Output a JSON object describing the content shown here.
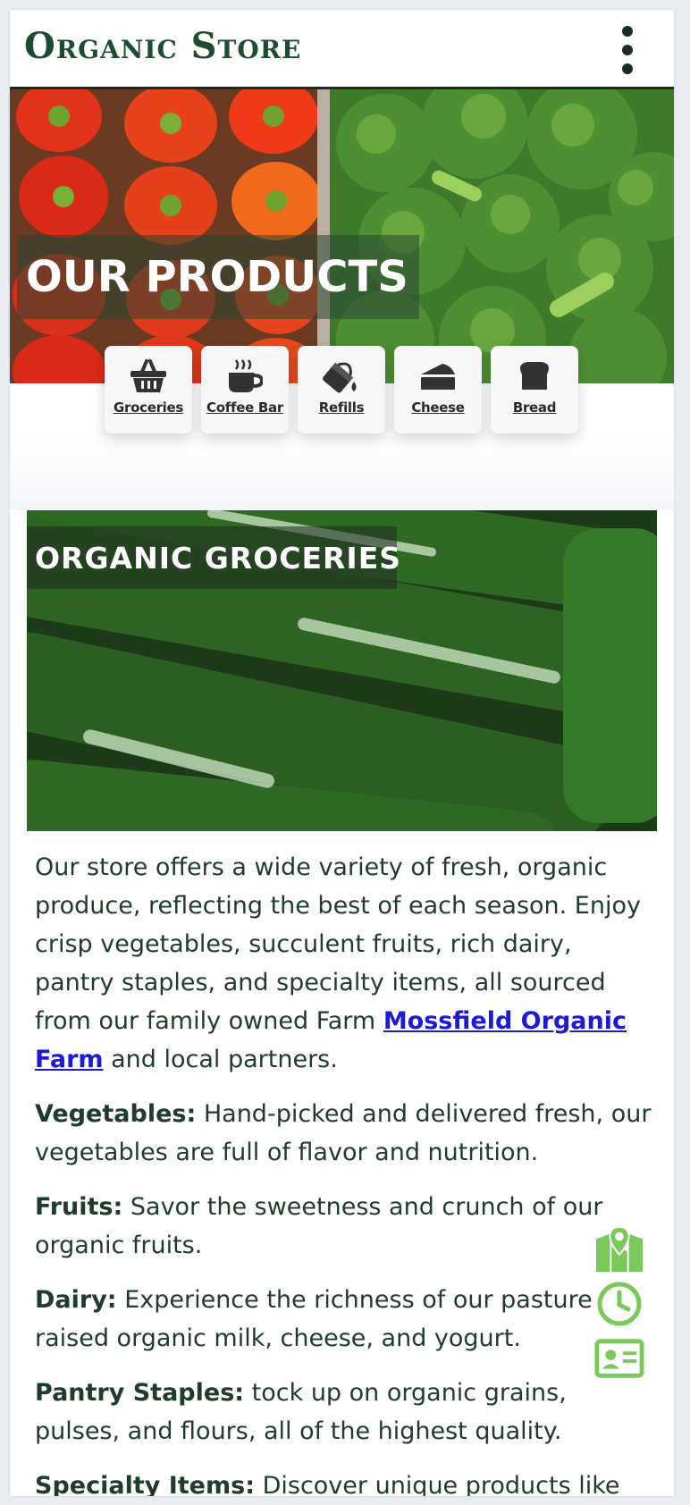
{
  "header": {
    "logo": "Organic Store",
    "menu_icon": "more-vertical-icon"
  },
  "hero": {
    "title": "OUR PRODUCTS"
  },
  "categories": [
    {
      "label": "Groceries",
      "icon": "basket-icon"
    },
    {
      "label": "Coffee Bar",
      "icon": "coffee-cup-icon"
    },
    {
      "label": "Refills",
      "icon": "paint-bucket-icon"
    },
    {
      "label": "Cheese",
      "icon": "cheese-icon"
    },
    {
      "label": "Bread",
      "icon": "bread-icon"
    }
  ],
  "section": {
    "title": "ORGANIC GROCERIES",
    "intro_text": "Our store offers a wide variety of fresh, organic produce, reflecting the best of each season. Enjoy crisp vegetables, succulent fruits, rich dairy, pantry staples, and specialty items, all sourced from our family owned Farm ",
    "intro_link": "Mossfield Organic Farm",
    "intro_tail": " and local partners.",
    "items": [
      {
        "label": "Vegetables:",
        "text": " Hand-picked and delivered fresh, our vegetables are full of flavor and nutrition."
      },
      {
        "label": "Fruits:",
        "text": " Savor the sweetness and crunch of our organic fruits."
      },
      {
        "label": "Dairy:",
        "text": " Experience the richness of our pasture raised organic milk, cheese, and yogurt."
      },
      {
        "label": "Pantry Staples:",
        "text": " tock up on organic grains, pulses, and flours, all of the highest quality."
      },
      {
        "label": "Specialty Items:",
        "text": " Discover unique products like"
      }
    ]
  },
  "floating_actions": [
    {
      "icon": "map-pin-icon"
    },
    {
      "icon": "clock-icon"
    },
    {
      "icon": "contact-card-icon"
    }
  ],
  "colors": {
    "brand_green": "#1d4d31",
    "accent_green": "#7bc95a",
    "link": "#1d1ad6"
  }
}
